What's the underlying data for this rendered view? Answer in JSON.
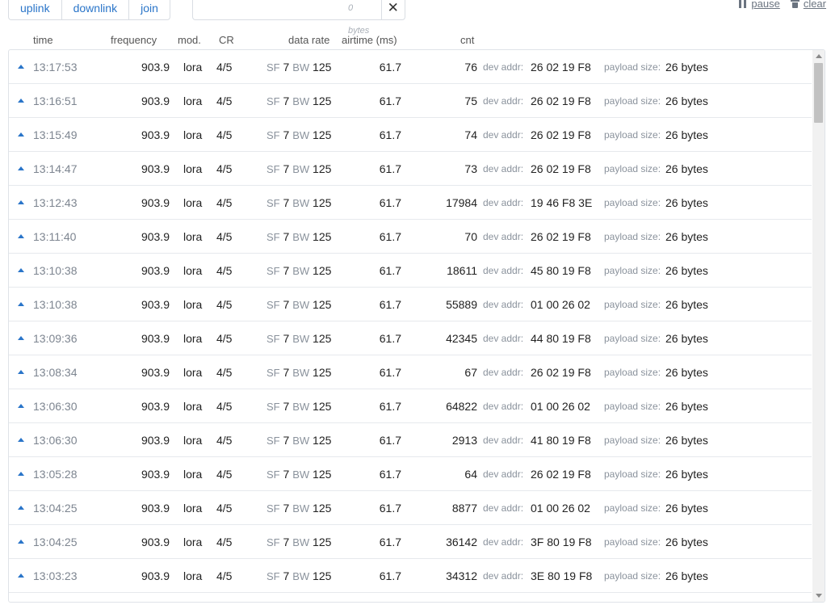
{
  "toolbar": {
    "filters": [
      "uplink",
      "downlink",
      "join"
    ],
    "search": {
      "value": "",
      "placeholder": ""
    },
    "bytes_label": "0 bytes",
    "clear_input_label": "✕",
    "pause_label": "pause",
    "clear_label": "clear"
  },
  "table": {
    "columns": [
      "time",
      "frequency",
      "mod.",
      "CR",
      "data rate",
      "airtime (ms)",
      "cnt"
    ],
    "dev_addr_label": "dev addr:",
    "payload_size_label": "payload size:",
    "sf_key": "SF",
    "bw_key": "BW",
    "rows": [
      {
        "time": "13:17:53",
        "frequency": "903.9",
        "mod": "lora",
        "cr": "4/5",
        "sf": "7",
        "bw": "125",
        "airtime": "61.7",
        "cnt": "76",
        "dev_addr": "26 02 19 F8",
        "payload": "26 bytes"
      },
      {
        "time": "13:16:51",
        "frequency": "903.9",
        "mod": "lora",
        "cr": "4/5",
        "sf": "7",
        "bw": "125",
        "airtime": "61.7",
        "cnt": "75",
        "dev_addr": "26 02 19 F8",
        "payload": "26 bytes"
      },
      {
        "time": "13:15:49",
        "frequency": "903.9",
        "mod": "lora",
        "cr": "4/5",
        "sf": "7",
        "bw": "125",
        "airtime": "61.7",
        "cnt": "74",
        "dev_addr": "26 02 19 F8",
        "payload": "26 bytes"
      },
      {
        "time": "13:14:47",
        "frequency": "903.9",
        "mod": "lora",
        "cr": "4/5",
        "sf": "7",
        "bw": "125",
        "airtime": "61.7",
        "cnt": "73",
        "dev_addr": "26 02 19 F8",
        "payload": "26 bytes"
      },
      {
        "time": "13:12:43",
        "frequency": "903.9",
        "mod": "lora",
        "cr": "4/5",
        "sf": "7",
        "bw": "125",
        "airtime": "61.7",
        "cnt": "17984",
        "dev_addr": "19 46 F8 3E",
        "payload": "26 bytes"
      },
      {
        "time": "13:11:40",
        "frequency": "903.9",
        "mod": "lora",
        "cr": "4/5",
        "sf": "7",
        "bw": "125",
        "airtime": "61.7",
        "cnt": "70",
        "dev_addr": "26 02 19 F8",
        "payload": "26 bytes"
      },
      {
        "time": "13:10:38",
        "frequency": "903.9",
        "mod": "lora",
        "cr": "4/5",
        "sf": "7",
        "bw": "125",
        "airtime": "61.7",
        "cnt": "18611",
        "dev_addr": "45 80 19 F8",
        "payload": "26 bytes"
      },
      {
        "time": "13:10:38",
        "frequency": "903.9",
        "mod": "lora",
        "cr": "4/5",
        "sf": "7",
        "bw": "125",
        "airtime": "61.7",
        "cnt": "55889",
        "dev_addr": "01 00 26 02",
        "payload": "26 bytes"
      },
      {
        "time": "13:09:36",
        "frequency": "903.9",
        "mod": "lora",
        "cr": "4/5",
        "sf": "7",
        "bw": "125",
        "airtime": "61.7",
        "cnt": "42345",
        "dev_addr": "44 80 19 F8",
        "payload": "26 bytes"
      },
      {
        "time": "13:08:34",
        "frequency": "903.9",
        "mod": "lora",
        "cr": "4/5",
        "sf": "7",
        "bw": "125",
        "airtime": "61.7",
        "cnt": "67",
        "dev_addr": "26 02 19 F8",
        "payload": "26 bytes"
      },
      {
        "time": "13:06:30",
        "frequency": "903.9",
        "mod": "lora",
        "cr": "4/5",
        "sf": "7",
        "bw": "125",
        "airtime": "61.7",
        "cnt": "64822",
        "dev_addr": "01 00 26 02",
        "payload": "26 bytes"
      },
      {
        "time": "13:06:30",
        "frequency": "903.9",
        "mod": "lora",
        "cr": "4/5",
        "sf": "7",
        "bw": "125",
        "airtime": "61.7",
        "cnt": "2913",
        "dev_addr": "41 80 19 F8",
        "payload": "26 bytes"
      },
      {
        "time": "13:05:28",
        "frequency": "903.9",
        "mod": "lora",
        "cr": "4/5",
        "sf": "7",
        "bw": "125",
        "airtime": "61.7",
        "cnt": "64",
        "dev_addr": "26 02 19 F8",
        "payload": "26 bytes"
      },
      {
        "time": "13:04:25",
        "frequency": "903.9",
        "mod": "lora",
        "cr": "4/5",
        "sf": "7",
        "bw": "125",
        "airtime": "61.7",
        "cnt": "8877",
        "dev_addr": "01 00 26 02",
        "payload": "26 bytes"
      },
      {
        "time": "13:04:25",
        "frequency": "903.9",
        "mod": "lora",
        "cr": "4/5",
        "sf": "7",
        "bw": "125",
        "airtime": "61.7",
        "cnt": "36142",
        "dev_addr": "3F 80 19 F8",
        "payload": "26 bytes"
      },
      {
        "time": "13:03:23",
        "frequency": "903.9",
        "mod": "lora",
        "cr": "4/5",
        "sf": "7",
        "bw": "125",
        "airtime": "61.7",
        "cnt": "34312",
        "dev_addr": "3E 80 19 F8",
        "payload": "26 bytes"
      }
    ]
  }
}
